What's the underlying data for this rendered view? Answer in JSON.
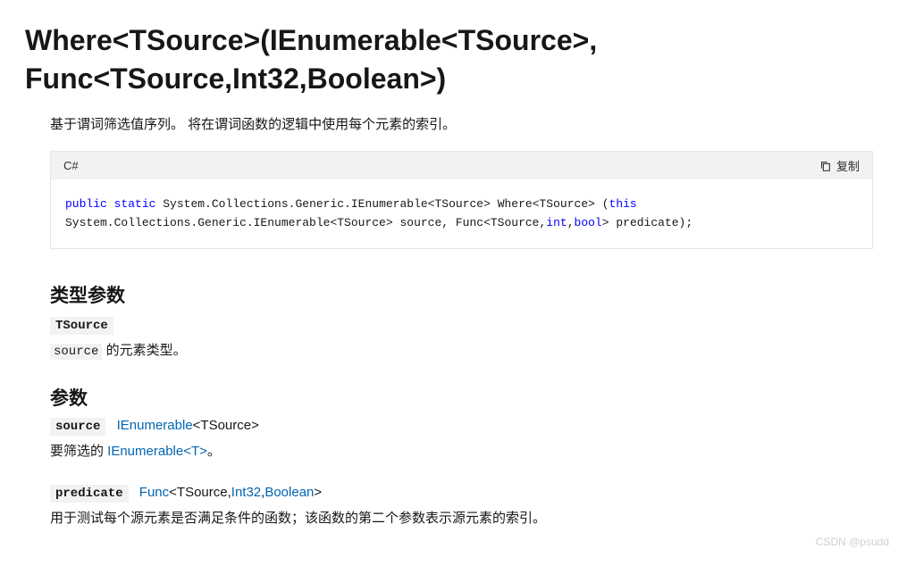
{
  "title": "Where<TSource>(IEnumerable<TSource>, Func<TSource,Int32,Boolean>)",
  "description": "基于谓词筛选值序列。 将在谓词函数的逻辑中使用每个元素的索引。",
  "code": {
    "lang": "C#",
    "copy_label": "复制",
    "tokens": {
      "public": "public",
      "static": "static",
      "this": "this",
      "int": "int",
      "bool": "bool"
    },
    "seg1": " System.Collections.Generic.IEnumerable<TSource> Where<TSource> (",
    "seg2": " System.Collections.Generic.IEnumerable<TSource> source, Func<TSource,",
    "seg3": ",",
    "seg4": "> predicate);"
  },
  "type_params": {
    "heading": "类型参数",
    "name": "TSource",
    "desc_pre": "",
    "desc_code": "source",
    "desc_post": " 的元素类型。"
  },
  "params": {
    "heading": "参数",
    "source": {
      "name": "source",
      "type_link": "IEnumerable",
      "type_generic": "<TSource>",
      "desc_pre": "要筛选的 ",
      "desc_link": "IEnumerable<T>",
      "desc_post": "。"
    },
    "predicate": {
      "name": "predicate",
      "type_link": "Func",
      "type_generic_pre": "<TSource,",
      "type_generic_link1": "Int32",
      "type_generic_mid": ",",
      "type_generic_link2": "Boolean",
      "type_generic_post": ">",
      "desc": "用于测试每个源元素是否满足条件的函数；该函数的第二个参数表示源元素的索引。"
    }
  },
  "watermark": "CSDN @psudd"
}
